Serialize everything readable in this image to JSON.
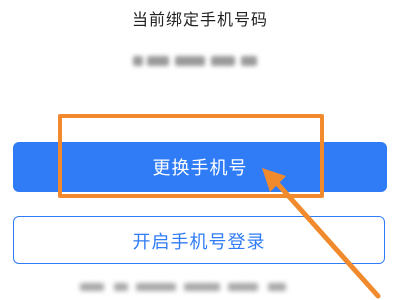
{
  "header": {
    "title": "当前绑定手机号码"
  },
  "actions": {
    "change_phone_label": "更换手机号",
    "enable_phone_login_label": "开启手机号登录"
  },
  "colors": {
    "primary": "#2f7cf6",
    "annotation": "#f08a2c"
  }
}
